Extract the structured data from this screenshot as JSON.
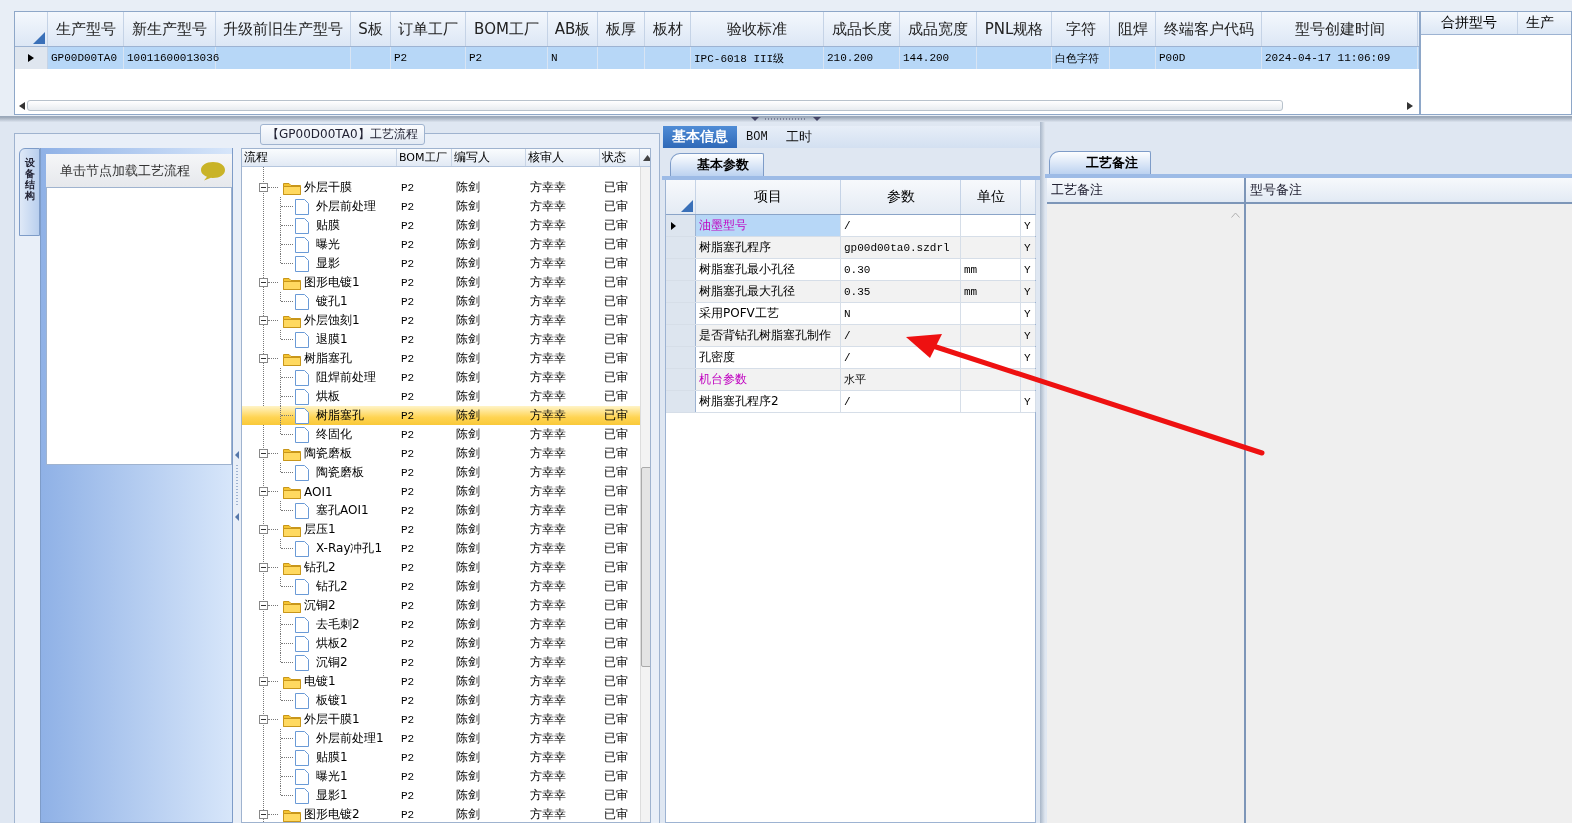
{
  "top_grid": {
    "columns": [
      "生产型号",
      "新生产型号",
      "升级前旧生产型号",
      "S板",
      "订单工厂",
      "BOM工厂",
      "AB板",
      "板厚",
      "板材",
      "验收标准",
      "成品长度",
      "成品宽度",
      "PNL规格",
      "字符",
      "阻焊",
      "终端客户代码",
      "型号创建时间"
    ],
    "rows": [
      {
        "selected": true,
        "cells": [
          "GP00D00TA0",
          "10011600013036",
          null,
          null,
          "P2",
          "P2",
          "N",
          null,
          null,
          "IPC-6018 III级",
          "210.200",
          "144.200",
          null,
          "白色字符",
          null,
          "P00D",
          "2024-04-17 11:06:09"
        ]
      }
    ]
  },
  "side_grid": {
    "columns": [
      "合拼型号",
      "生产"
    ]
  },
  "flow_panel": {
    "title": "【GP00D00TA0】工艺流程",
    "side_tab": "设备结构",
    "hint": "单击节点加载工艺流程",
    "tree": {
      "columns": [
        "流程",
        "BOM工厂",
        "编写人",
        "核审人",
        "状态"
      ],
      "nodes": [
        {
          "kind": "folder",
          "name": "外层干膜",
          "bom": "P2",
          "writer": "陈剑",
          "reviewer": "方幸幸",
          "status": "已审",
          "expanded": true,
          "selected": false,
          "children": [
            {
              "kind": "step",
              "name": "外层前处理",
              "bom": "P2",
              "writer": "陈剑",
              "reviewer": "方幸幸",
              "status": "已审",
              "selected": false
            },
            {
              "kind": "step",
              "name": "贴膜",
              "bom": "P2",
              "writer": "陈剑",
              "reviewer": "方幸幸",
              "status": "已审",
              "selected": false
            },
            {
              "kind": "step",
              "name": "曝光",
              "bom": "P2",
              "writer": "陈剑",
              "reviewer": "方幸幸",
              "status": "已审",
              "selected": false
            },
            {
              "kind": "step",
              "name": "显影",
              "bom": "P2",
              "writer": "陈剑",
              "reviewer": "方幸幸",
              "status": "已审",
              "selected": false
            }
          ]
        },
        {
          "kind": "folder",
          "name": "图形电镀1",
          "bom": "P2",
          "writer": "陈剑",
          "reviewer": "方幸幸",
          "status": "已审",
          "expanded": true,
          "selected": false,
          "children": [
            {
              "kind": "step",
              "name": "镀孔1",
              "bom": "P2",
              "writer": "陈剑",
              "reviewer": "方幸幸",
              "status": "已审",
              "selected": false
            }
          ]
        },
        {
          "kind": "folder",
          "name": "外层蚀刻1",
          "bom": "P2",
          "writer": "陈剑",
          "reviewer": "方幸幸",
          "status": "已审",
          "expanded": true,
          "selected": false,
          "children": [
            {
              "kind": "step",
              "name": "退膜1",
              "bom": "P2",
              "writer": "陈剑",
              "reviewer": "方幸幸",
              "status": "已审",
              "selected": false
            }
          ]
        },
        {
          "kind": "folder",
          "name": "树脂塞孔",
          "bom": "P2",
          "writer": "陈剑",
          "reviewer": "方幸幸",
          "status": "已审",
          "expanded": true,
          "selected": false,
          "children": [
            {
              "kind": "step",
              "name": "阻焊前处理",
              "bom": "P2",
              "writer": "陈剑",
              "reviewer": "方幸幸",
              "status": "已审",
              "selected": false
            },
            {
              "kind": "step",
              "name": "烘板",
              "bom": "P2",
              "writer": "陈剑",
              "reviewer": "方幸幸",
              "status": "已审",
              "selected": false
            },
            {
              "kind": "step",
              "name": "树脂塞孔",
              "bom": "P2",
              "writer": "陈剑",
              "reviewer": "方幸幸",
              "status": "已审",
              "selected": true
            },
            {
              "kind": "step",
              "name": "终固化",
              "bom": "P2",
              "writer": "陈剑",
              "reviewer": "方幸幸",
              "status": "已审",
              "selected": false
            }
          ]
        },
        {
          "kind": "folder",
          "name": "陶瓷磨板",
          "bom": "P2",
          "writer": "陈剑",
          "reviewer": "方幸幸",
          "status": "已审",
          "expanded": true,
          "selected": false,
          "children": [
            {
              "kind": "step",
              "name": "陶瓷磨板",
              "bom": "P2",
              "writer": "陈剑",
              "reviewer": "方幸幸",
              "status": "已审",
              "selected": false
            }
          ]
        },
        {
          "kind": "folder",
          "name": "AOI1",
          "bom": "P2",
          "writer": "陈剑",
          "reviewer": "方幸幸",
          "status": "已审",
          "expanded": true,
          "selected": false,
          "children": [
            {
              "kind": "step",
              "name": "塞孔AOI1",
              "bom": "P2",
              "writer": "陈剑",
              "reviewer": "方幸幸",
              "status": "已审",
              "selected": false
            }
          ]
        },
        {
          "kind": "folder",
          "name": "层压1",
          "bom": "P2",
          "writer": "陈剑",
          "reviewer": "方幸幸",
          "status": "已审",
          "expanded": true,
          "selected": false,
          "children": [
            {
              "kind": "step",
              "name": "X-Ray冲孔1",
              "bom": "P2",
              "writer": "陈剑",
              "reviewer": "方幸幸",
              "status": "已审",
              "selected": false
            }
          ]
        },
        {
          "kind": "folder",
          "name": "钻孔2",
          "bom": "P2",
          "writer": "陈剑",
          "reviewer": "方幸幸",
          "status": "已审",
          "expanded": true,
          "selected": false,
          "children": [
            {
              "kind": "step",
              "name": "钻孔2",
              "bom": "P2",
              "writer": "陈剑",
              "reviewer": "方幸幸",
              "status": "已审",
              "selected": false
            }
          ]
        },
        {
          "kind": "folder",
          "name": "沉铜2",
          "bom": "P2",
          "writer": "陈剑",
          "reviewer": "方幸幸",
          "status": "已审",
          "expanded": true,
          "selected": false,
          "children": [
            {
              "kind": "step",
              "name": "去毛刺2",
              "bom": "P2",
              "writer": "陈剑",
              "reviewer": "方幸幸",
              "status": "已审",
              "selected": false
            },
            {
              "kind": "step",
              "name": "烘板2",
              "bom": "P2",
              "writer": "陈剑",
              "reviewer": "方幸幸",
              "status": "已审",
              "selected": false
            },
            {
              "kind": "step",
              "name": "沉铜2",
              "bom": "P2",
              "writer": "陈剑",
              "reviewer": "方幸幸",
              "status": "已审",
              "selected": false
            }
          ]
        },
        {
          "kind": "folder",
          "name": "电镀1",
          "bom": "P2",
          "writer": "陈剑",
          "reviewer": "方幸幸",
          "status": "已审",
          "expanded": true,
          "selected": false,
          "children": [
            {
              "kind": "step",
              "name": "板镀1",
              "bom": "P2",
              "writer": "陈剑",
              "reviewer": "方幸幸",
              "status": "已审",
              "selected": false
            }
          ]
        },
        {
          "kind": "folder",
          "name": "外层干膜1",
          "bom": "P2",
          "writer": "陈剑",
          "reviewer": "方幸幸",
          "status": "已审",
          "expanded": true,
          "selected": false,
          "children": [
            {
              "kind": "step",
              "name": "外层前处理1",
              "bom": "P2",
              "writer": "陈剑",
              "reviewer": "方幸幸",
              "status": "已审",
              "selected": false
            },
            {
              "kind": "step",
              "name": "贴膜1",
              "bom": "P2",
              "writer": "陈剑",
              "reviewer": "方幸幸",
              "status": "已审",
              "selected": false
            },
            {
              "kind": "step",
              "name": "曝光1",
              "bom": "P2",
              "writer": "陈剑",
              "reviewer": "方幸幸",
              "status": "已审",
              "selected": false
            },
            {
              "kind": "step",
              "name": "显影1",
              "bom": "P2",
              "writer": "陈剑",
              "reviewer": "方幸幸",
              "status": "已审",
              "selected": false
            }
          ]
        },
        {
          "kind": "folder",
          "name": "图形电镀2",
          "bom": "P2",
          "writer": "陈剑",
          "reviewer": "方幸幸",
          "status": "已审",
          "expanded": true,
          "selected": false
        }
      ]
    }
  },
  "detail": {
    "tabs": [
      {
        "label": "基本信息",
        "selected": true
      },
      {
        "label": "BOM",
        "selected": false
      },
      {
        "label": "工时",
        "selected": false
      }
    ],
    "param_tab": "基本参数",
    "params": {
      "columns": [
        "项目",
        "参数",
        "单位"
      ],
      "rows": [
        {
          "item": "油墨型号",
          "highlighted": true,
          "value": "/",
          "flag": "Y",
          "selected": true
        },
        {
          "item": "树脂塞孔程序",
          "highlighted": false,
          "value": "gp00d00ta0.szdrl",
          "flag": "Y",
          "selected": false
        },
        {
          "item": "树脂塞孔最小孔径",
          "highlighted": false,
          "value": "0.30",
          "unit": "mm",
          "flag": "Y",
          "selected": false
        },
        {
          "item": "树脂塞孔最大孔径",
          "highlighted": false,
          "value": "0.35",
          "unit": "mm",
          "flag": "Y",
          "selected": false
        },
        {
          "item": "采用POFV工艺",
          "highlighted": false,
          "value": "N",
          "flag": "Y",
          "selected": false
        },
        {
          "item": "是否背钻孔树脂塞孔制作",
          "highlighted": false,
          "value": "/",
          "flag": "Y",
          "selected": false
        },
        {
          "item": "孔密度",
          "highlighted": false,
          "value": "/",
          "flag": "Y",
          "selected": false
        },
        {
          "item": "机台参数",
          "highlighted": true,
          "value": "水平",
          "selected": false
        },
        {
          "item": "树脂塞孔程序2",
          "highlighted": false,
          "value": "/",
          "flag": "Y",
          "selected": false
        }
      ]
    }
  },
  "notes": {
    "tab": "工艺备注",
    "columns": [
      "工艺备注",
      "型号备注"
    ]
  }
}
